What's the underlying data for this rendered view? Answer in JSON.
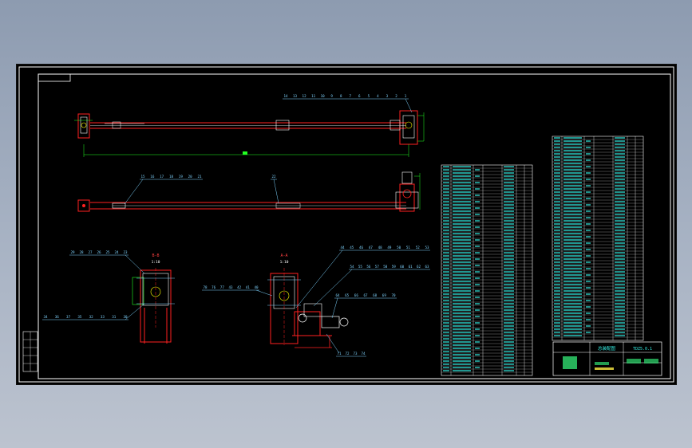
{
  "title_block": {
    "drawing_title": "总装配图",
    "drawing_number": "TDZ5.0.1",
    "scale": "1:10"
  },
  "section_labels": [
    {
      "id": "bb",
      "title": "B-B",
      "scale": "1:10"
    },
    {
      "id": "aa",
      "title": "A-A",
      "scale": "1:10"
    }
  ],
  "callouts": {
    "top_row": [
      "14",
      "13",
      "12",
      "11",
      "10",
      "9",
      "8",
      "7",
      "6",
      "5",
      "4",
      "3",
      "2",
      "1"
    ],
    "middle_row": [
      "15",
      "16",
      "17",
      "18",
      "19",
      "20",
      "21"
    ],
    "middle_single": [
      "22"
    ],
    "bb_top": [
      "29",
      "28",
      "27",
      "26",
      "25",
      "24",
      "23"
    ],
    "bb_bottom": [
      "34",
      "36",
      "37",
      "35",
      "32",
      "33",
      "31",
      "30"
    ],
    "aa_left": [
      "78",
      "76",
      "77",
      "43",
      "42",
      "41",
      "40"
    ],
    "aa_top": [
      "44",
      "45",
      "46",
      "47",
      "48",
      "49",
      "50",
      "51",
      "52",
      "53"
    ],
    "aa_upper": [
      "54",
      "55",
      "56",
      "57",
      "58",
      "59",
      "60",
      "61",
      "62",
      "63"
    ],
    "aa_right": [
      "64",
      "65",
      "66",
      "67",
      "68",
      "69",
      "70"
    ],
    "aa_bottom": [
      "71",
      "72",
      "73",
      "74"
    ]
  },
  "colors": {
    "background": "#000000",
    "frame": "#ffffff",
    "part": "#ff2020",
    "dimension": "#22ff22",
    "callout": "#7fd4ff",
    "table_text": "#35f0e6",
    "table_grid": "#ffffff",
    "outer": "#a8b3c4"
  }
}
